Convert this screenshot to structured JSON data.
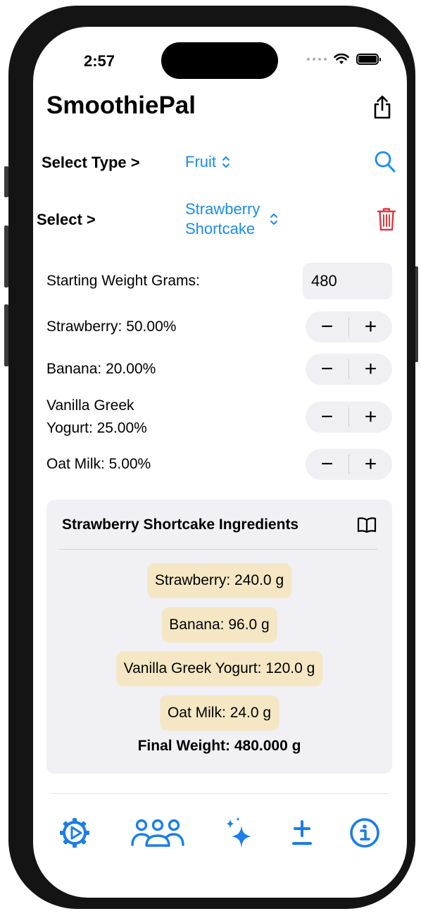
{
  "status": {
    "time": "2:57"
  },
  "app": {
    "title": "SmoothiePal"
  },
  "type_row": {
    "label": "Select Type >",
    "value": "Fruit"
  },
  "recipe_row": {
    "label": "Select >",
    "value_line1": "Strawberry",
    "value_line2": "Shortcake"
  },
  "starting_weight": {
    "label": "Starting Weight Grams:",
    "value": "480"
  },
  "ingredients": [
    {
      "label": "Strawberry: 50.00%"
    },
    {
      "label": "Banana: 20.00%"
    },
    {
      "label_line1": "Vanilla Greek",
      "label_line2": "Yogurt: 25.00%"
    },
    {
      "label": "Oat Milk: 5.00%"
    }
  ],
  "stepper": {
    "minus": "−",
    "plus": "+"
  },
  "summary": {
    "title": "Strawberry Shortcake Ingredients",
    "chips": [
      "Strawberry: 240.0 g",
      "Banana: 96.0 g",
      "Vanilla Greek Yogurt: 120.0 g",
      "Oat Milk: 24.0 g"
    ],
    "final_weight": "Final Weight: 480.000 g"
  },
  "tabbar": {
    "icons": [
      "settings-gear-icon",
      "people-group-icon",
      "sparkles-icon",
      "plus-minus-icon",
      "info-icon"
    ]
  },
  "colors": {
    "accent": "#1a8cf0",
    "tab_blue": "#1a7ee6",
    "delete_red": "#e0393e",
    "chip_bg": "#f5e7c4",
    "card_bg": "#f0f0f5",
    "control_bg": "#efeff4"
  }
}
